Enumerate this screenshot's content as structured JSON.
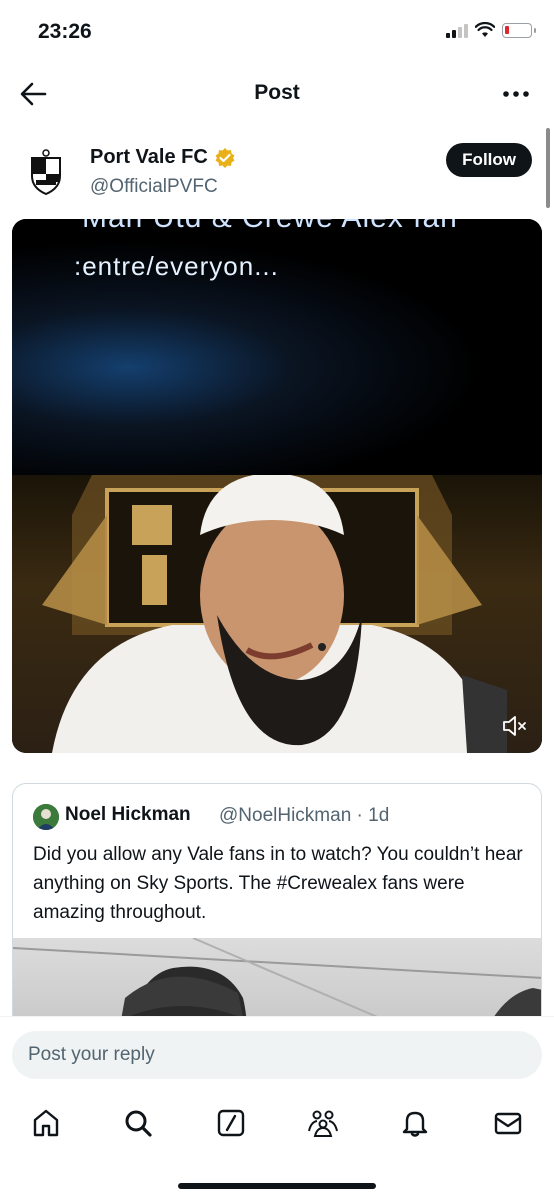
{
  "status_bar": {
    "time": "23:26"
  },
  "header": {
    "title": "Post"
  },
  "post": {
    "author_name": "Port Vale FC",
    "author_handle": "@OfficialPVFC",
    "follow_label": "Follow",
    "media": {
      "overlay_text_top": "Man Utd & Crewe Alex fan",
      "overlay_text": ":entre/everyon..."
    }
  },
  "quoted_post": {
    "author_name": "Noel Hickman",
    "author_handle": "@NoelHickman",
    "time": "1d",
    "text": "Did you allow any Vale fans in to watch? You couldn’t hear anything on Sky Sports. The #Crewealex fans were amazing throughout."
  },
  "reply": {
    "placeholder": "Post your reply"
  },
  "colors": {
    "accent": "#0f1419",
    "verified": "#e8b11a",
    "muted_text": "#536471"
  }
}
